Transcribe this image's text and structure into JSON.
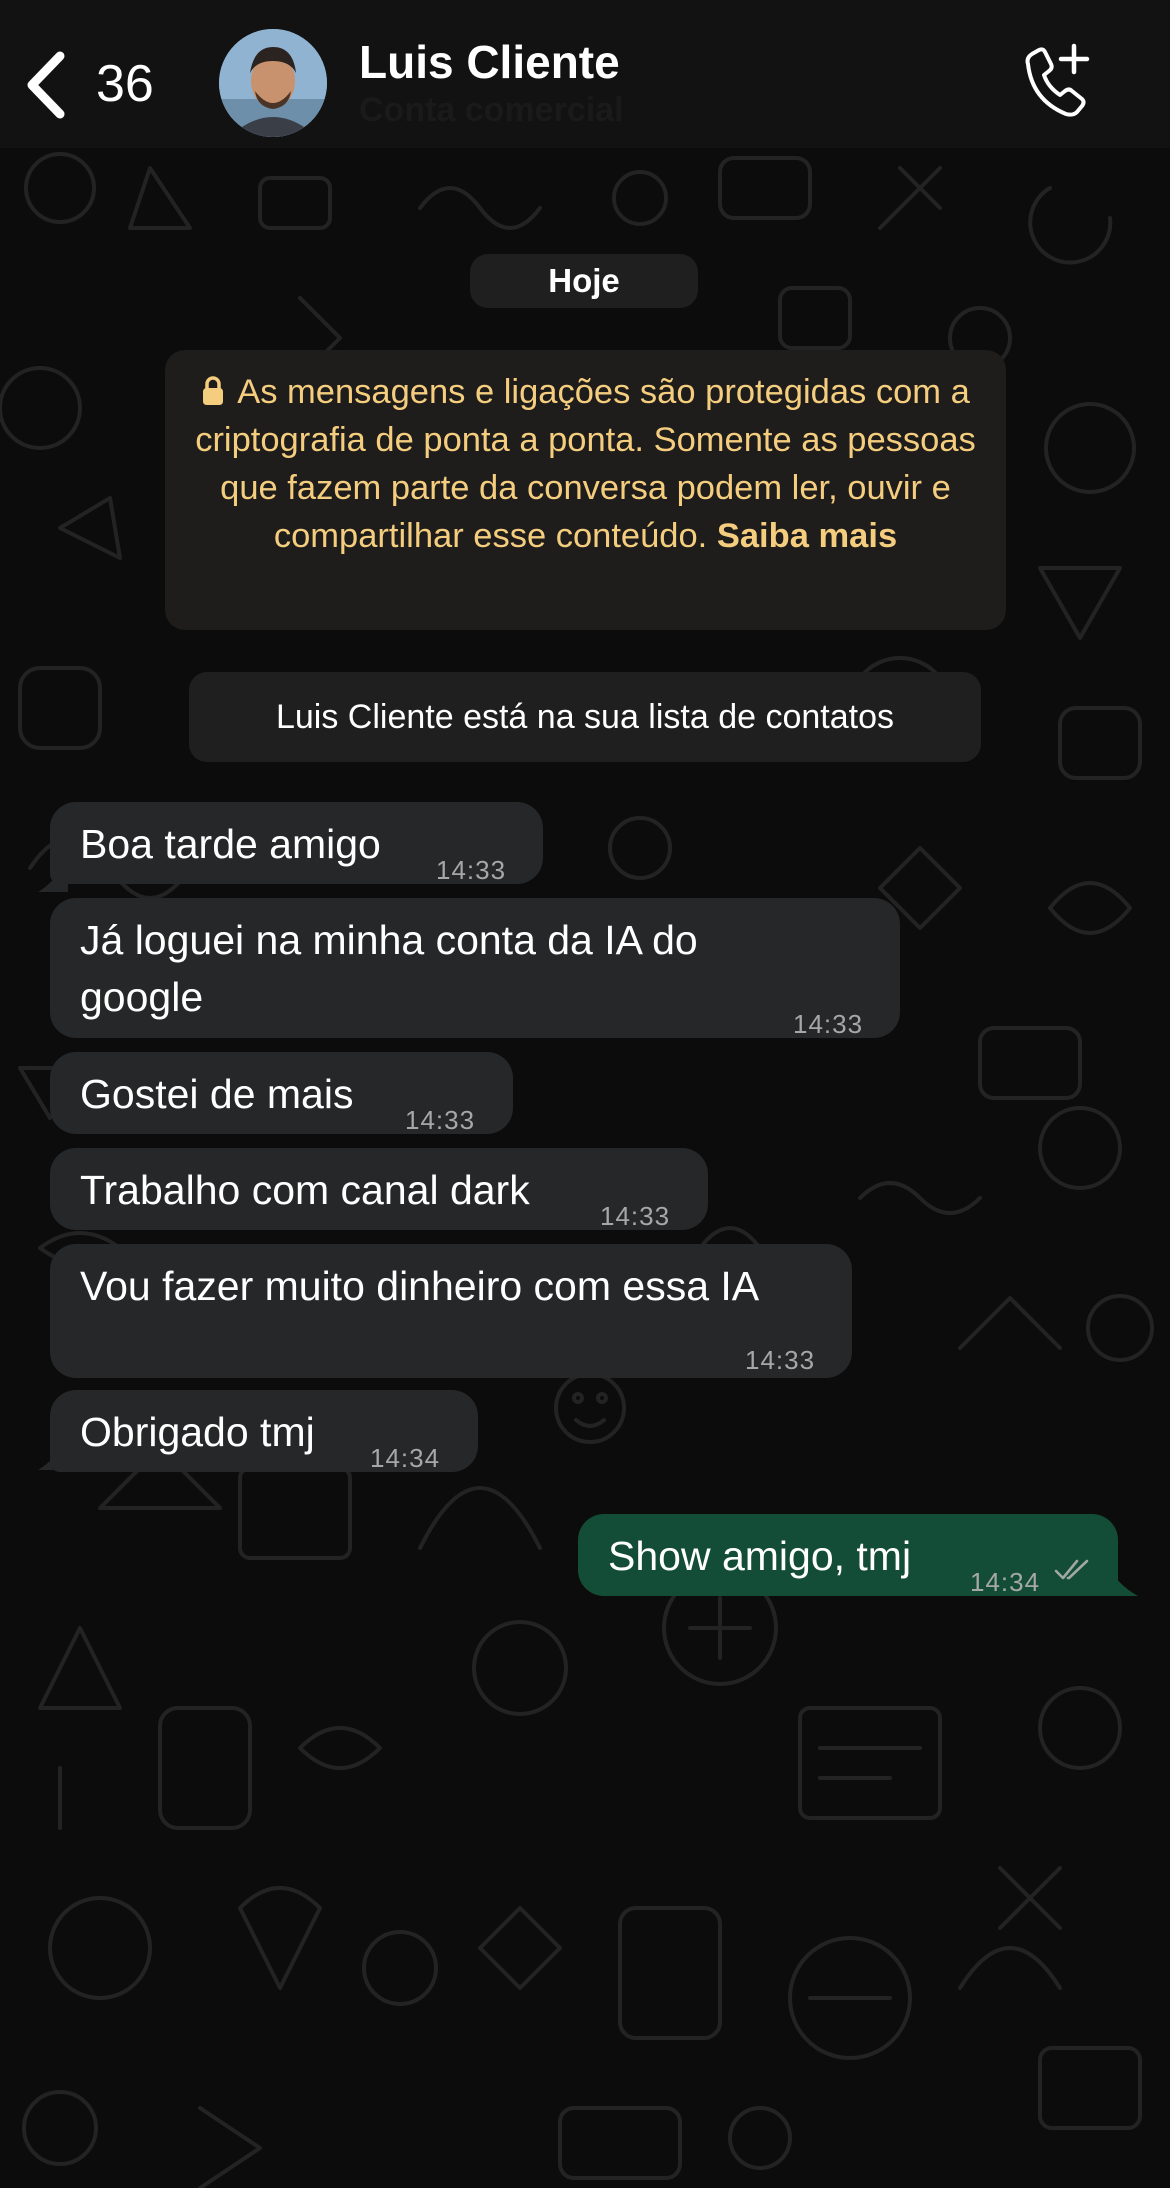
{
  "header": {
    "back_count": "36",
    "contact_name": "Luis Cliente",
    "contact_subtitle": "Conta comercial"
  },
  "chat": {
    "date_label": "Hoje",
    "encryption_notice": "As mensagens e ligações são protegidas com a criptografia de ponta a ponta. Somente as pessoas que fazem parte da conversa podem ler, ouvir e compartilhar esse conteúdo.",
    "encryption_link": "Saiba mais",
    "contact_notice": "Luis Cliente está na sua lista de contatos",
    "messages": [
      {
        "direction": "incoming",
        "text": "Boa tarde amigo",
        "time": "14:33"
      },
      {
        "direction": "incoming",
        "text_line1": "Já loguei na minha conta da IA do",
        "text_line2": "google",
        "time": "14:33"
      },
      {
        "direction": "incoming",
        "text": "Gostei de mais",
        "time": "14:33"
      },
      {
        "direction": "incoming",
        "text": "Trabalho com canal dark",
        "time": "14:33"
      },
      {
        "direction": "incoming",
        "text": "Vou fazer muito dinheiro com essa IA",
        "time": "14:33"
      },
      {
        "direction": "incoming",
        "text": "Obrigado tmj",
        "time": "14:34"
      },
      {
        "direction": "outgoing",
        "text": "Show amigo, tmj",
        "time": "14:34",
        "status": "read"
      }
    ]
  },
  "icons": {
    "back": "chevron-left-icon",
    "call": "phone-plus-icon",
    "lock": "lock-icon",
    "read_receipt": "double-check-icon"
  },
  "colors": {
    "header_bg": "#121212",
    "incoming_bubble": "#262728",
    "outgoing_bubble": "#144d37",
    "encryption_text": "#f5cd7e",
    "timestamp": "#a6a7a9"
  }
}
